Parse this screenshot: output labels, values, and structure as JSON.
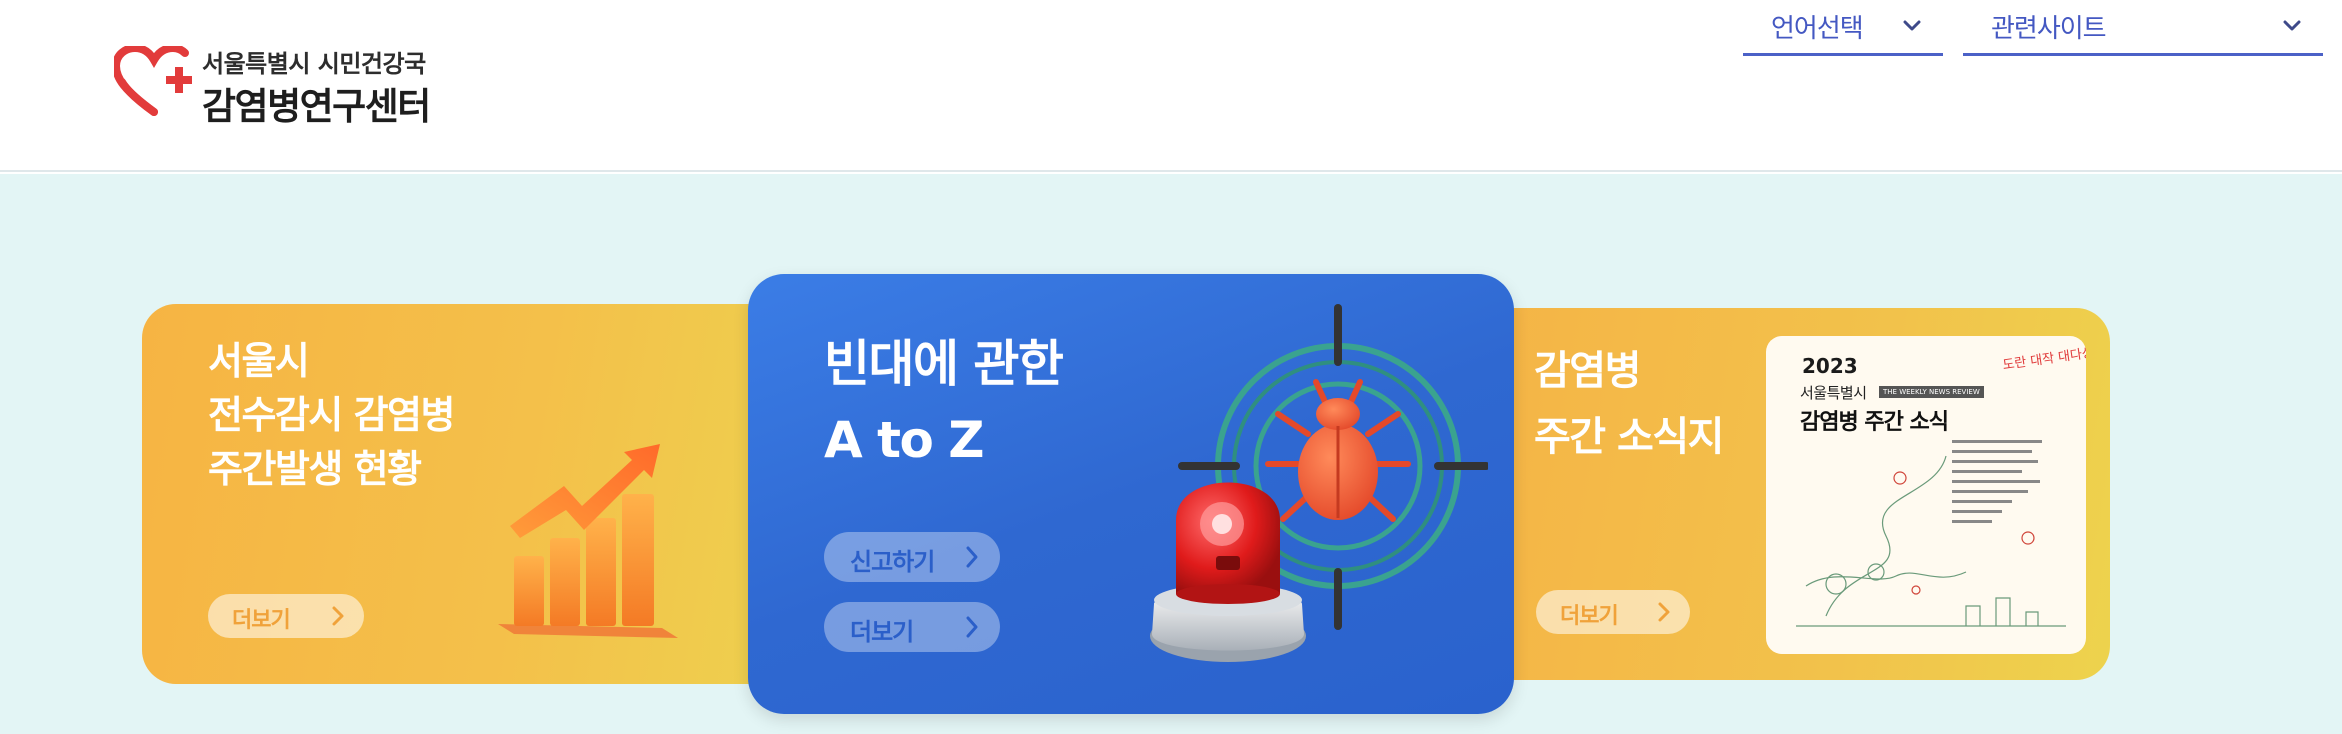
{
  "header": {
    "logo_top": "서울특별시 시민건강국",
    "logo_main": "감염병연구센터",
    "language_select": "언어선택",
    "related_sites_select": "관련사이트"
  },
  "cards": {
    "left": {
      "title_lines": [
        "서울시",
        "전수감시 감염병",
        "주간발생 현황"
      ],
      "more_label": "더보기"
    },
    "center": {
      "title_lines": [
        "빈대에 관한",
        "A to Z"
      ],
      "report_label": "신고하기",
      "more_label": "더보기"
    },
    "right": {
      "title_lines": [
        "감염병",
        "주간 소식지"
      ],
      "more_label": "더보기",
      "poster": {
        "year": "2023",
        "subtitle": "서울특별시",
        "tag": "THE WEEKLY NEWS REVIEW",
        "title": "감염병 주간 소식",
        "handwriting": "도란 대작 대다상"
      }
    }
  },
  "colors": {
    "accent_blue": "#4458c2",
    "card_orange": "#f5b446",
    "card_blue": "#2f68d1",
    "background": "#e3f5f5"
  }
}
